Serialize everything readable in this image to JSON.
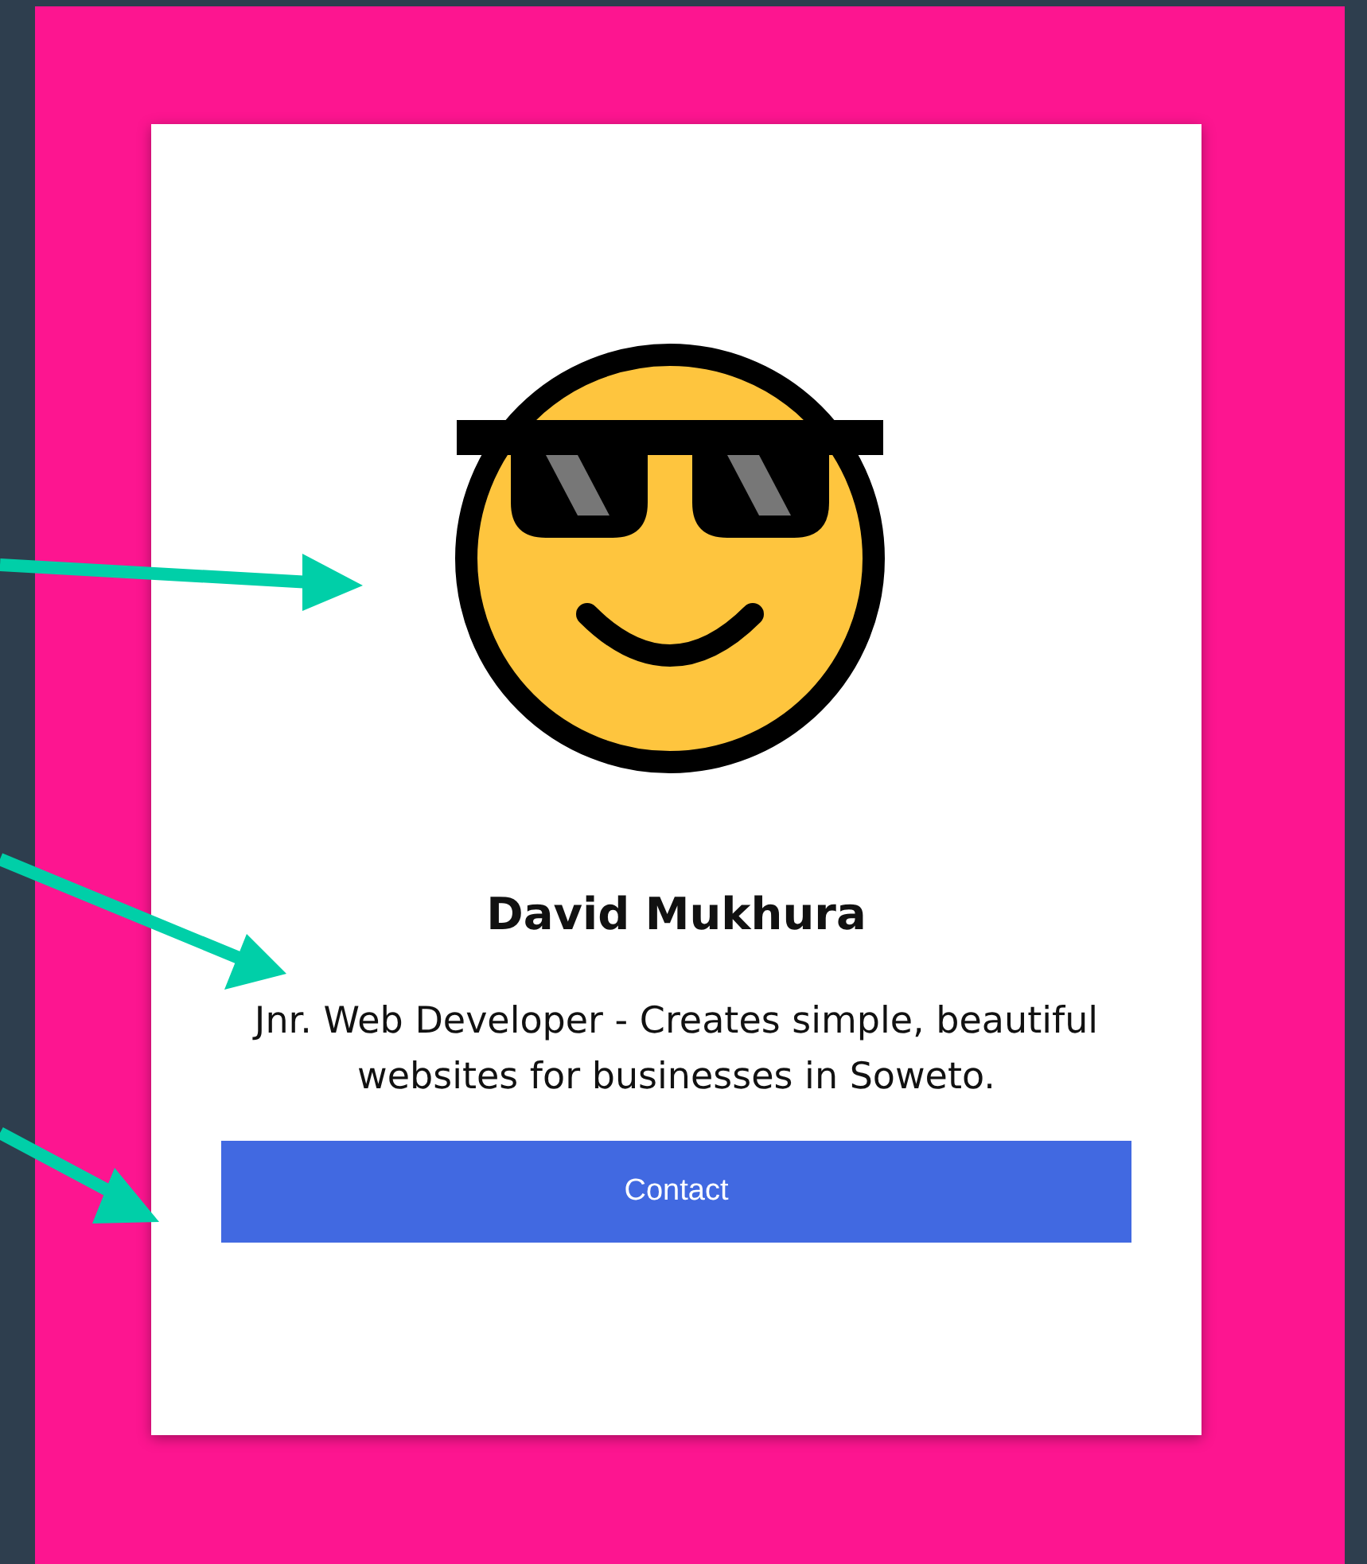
{
  "card": {
    "name": "David Mukhura",
    "description": "Jnr. Web Developer - Creates simple, beautiful websites for businesses in Soweto.",
    "button": "Contact"
  }
}
